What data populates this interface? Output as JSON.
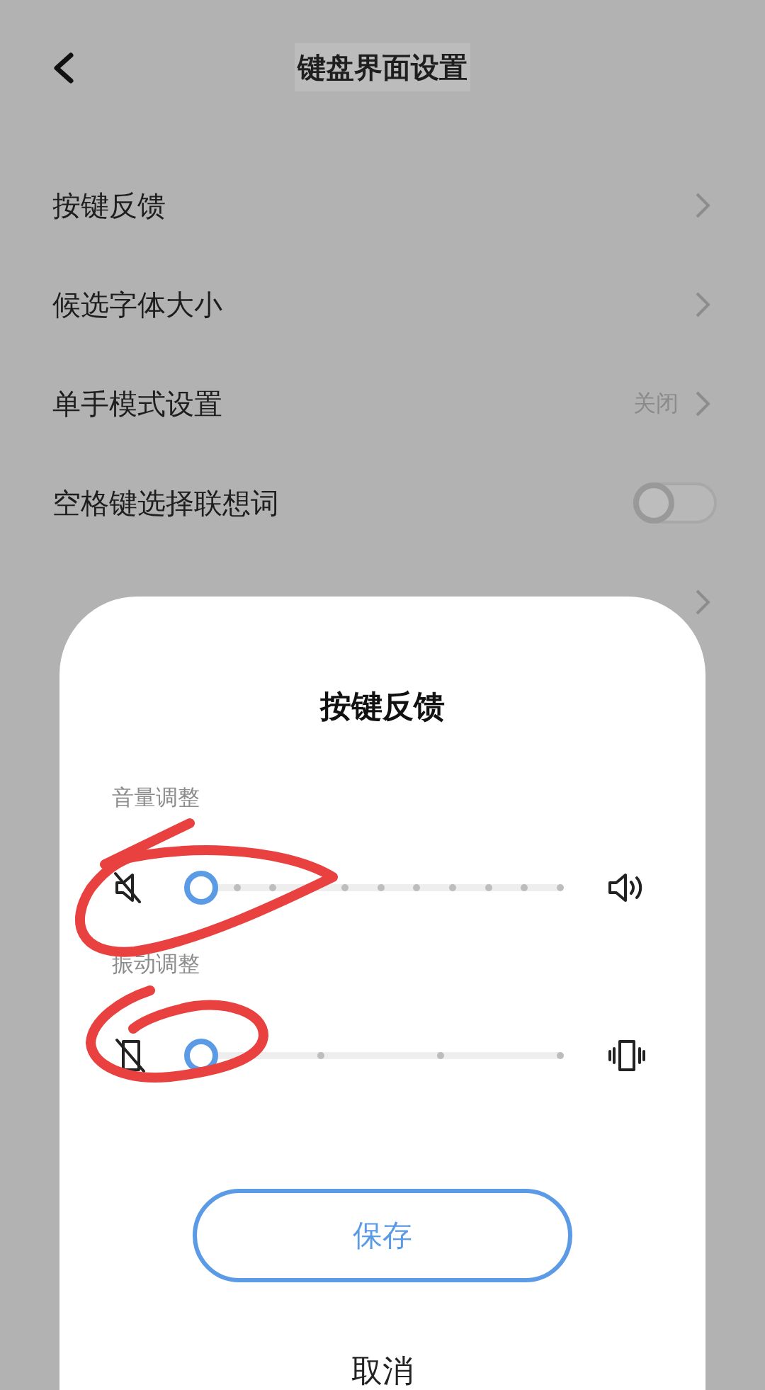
{
  "header": {
    "title": "键盘界面设置"
  },
  "settings": [
    {
      "kind": "link",
      "label": "按键反馈"
    },
    {
      "kind": "link",
      "label": "候选字体大小"
    },
    {
      "kind": "link",
      "label": "单手模式设置",
      "value": "关闭"
    },
    {
      "kind": "toggle",
      "label": "空格键选择联想词",
      "on": false
    },
    {
      "kind": "link"
    }
  ],
  "dialog": {
    "title": "按键反馈",
    "sliders": [
      {
        "kind": "volume",
        "label": "音量调整",
        "level": 0
      },
      {
        "kind": "vibration",
        "label": "振动调整",
        "level": 0
      }
    ],
    "buttons": [
      {
        "kind": "primary",
        "label": "保存"
      },
      {
        "kind": "plain",
        "label": "取消"
      }
    ]
  }
}
